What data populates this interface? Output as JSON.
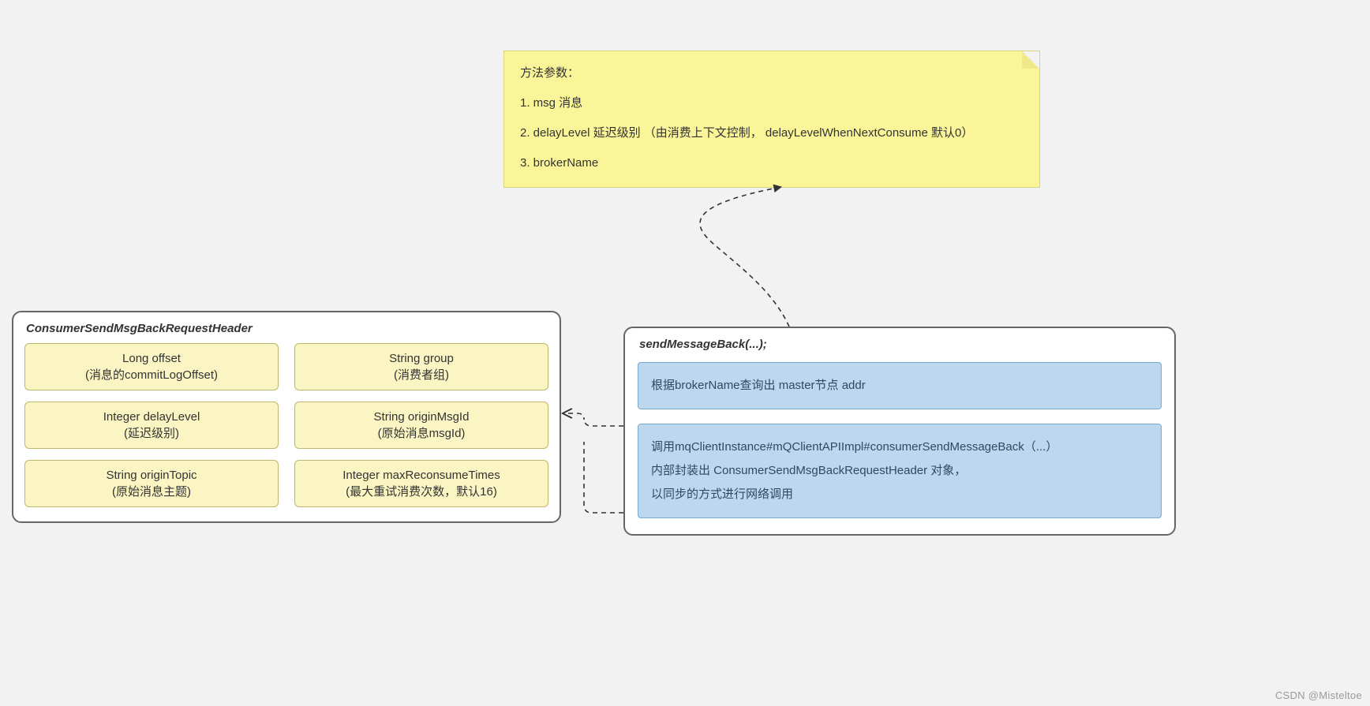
{
  "note": {
    "header": "方法参数：",
    "line1": "1.  msg  消息",
    "line2": "2.  delayLevel 延迟级别 （由消费上下文控制， delayLevelWhenNextConsume  默认0）",
    "line3": "3.  brokerName"
  },
  "leftBox": {
    "title": "ConsumerSendMsgBackRequestHeader",
    "fields": [
      {
        "name": "Long offset",
        "desc": "(消息的commitLogOffset)"
      },
      {
        "name": "String group",
        "desc": "(消费者组)"
      },
      {
        "name": "Integer delayLevel",
        "desc": "(延迟级别)"
      },
      {
        "name": "String originMsgId",
        "desc": "(原始消息msgId)"
      },
      {
        "name": "String originTopic",
        "desc": "(原始消息主题)"
      },
      {
        "name": "Integer maxReconsumeTimes",
        "desc": "(最大重试消费次数，默认16)"
      }
    ]
  },
  "rightBox": {
    "title": "sendMessageBack(...);",
    "step1": "根据brokerName查询出 master节点 addr",
    "step2": {
      "l1": "调用mqClientInstance#mQClientAPIImpl#consumerSendMessageBack（...）",
      "l2": "内部封装出  ConsumerSendMsgBackRequestHeader  对象，",
      "l3": "以同步的方式进行网络调用"
    }
  },
  "watermark": "CSDN @Misteltoe"
}
